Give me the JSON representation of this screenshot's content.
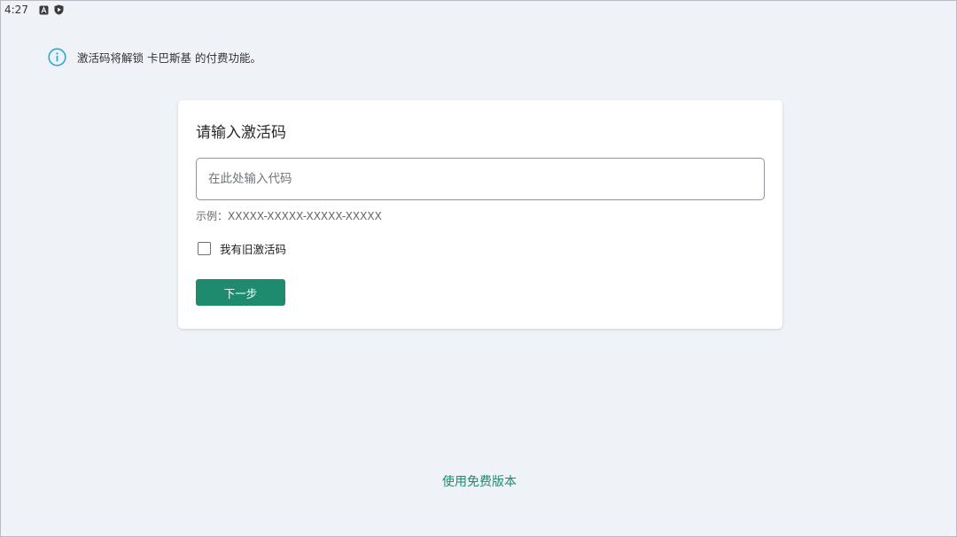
{
  "status_bar": {
    "time": "4:27",
    "icons": [
      "a-letter-icon",
      "shield-play-icon"
    ]
  },
  "info": {
    "icon": "info-circle-icon",
    "text": "激活码将解锁 卡巴斯基 的付费功能。",
    "icon_color": "#29a8e0"
  },
  "card": {
    "title": "请输入激活码",
    "input": {
      "value": "",
      "placeholder": "在此处输入代码"
    },
    "example": "示例：XXXXX-XXXXX-XXXXX-XXXXX",
    "checkbox": {
      "label": "我有旧激活码",
      "checked": false
    },
    "next_button": "下一步"
  },
  "footer": {
    "free_version_link": "使用免费版本"
  },
  "colors": {
    "accent": "#1e8a6e",
    "background": "#eff2f6"
  }
}
